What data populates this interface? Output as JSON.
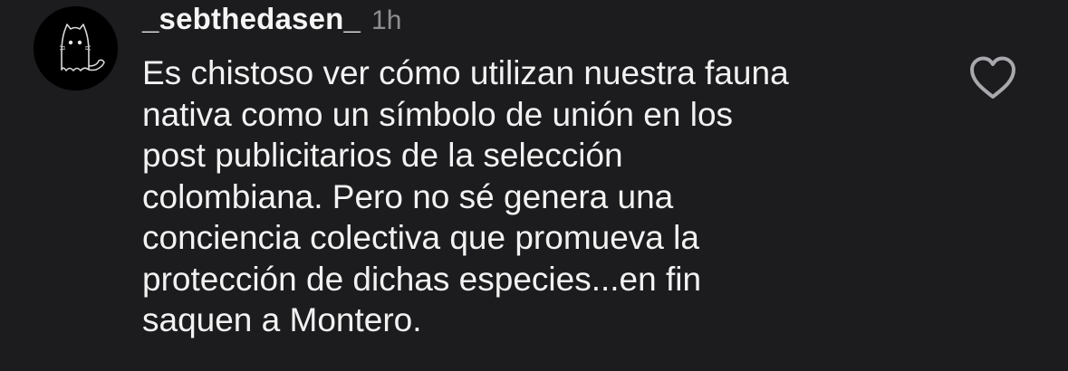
{
  "comment": {
    "username": "_sebthedasen_",
    "timestamp": "1h",
    "text": "Es chistoso ver cómo utilizan nuestra fauna\nnativa como un símbolo de unión en los\npost publicitarios de la selección\ncolombiana. Pero no sé genera una\nconciencia colectiva que promueva la\nprotección de dichas especies...en fin\nsaquen a Montero.",
    "avatar_icon": "ghost-cat-icon",
    "like_icon": "heart-outline-icon",
    "liked": false
  },
  "theme": {
    "background": "#1c1c1e",
    "text": "#f2f2f2",
    "muted": "#8e8e93"
  }
}
